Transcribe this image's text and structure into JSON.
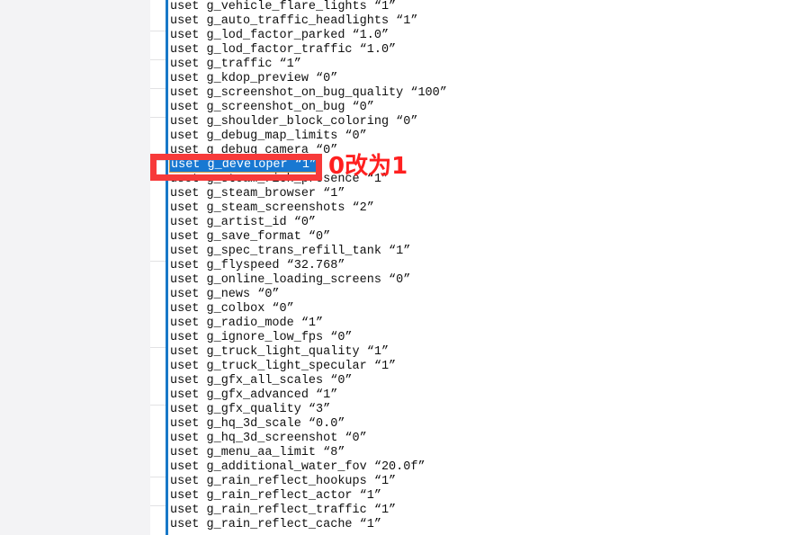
{
  "document": {
    "type": "config-file-text",
    "background_color": "#ffffff",
    "page_backdrop_color": "#f3f3f5",
    "code_bar_color": "#1878c8",
    "text_color": "#101010",
    "line_height_px": 16,
    "lines": [
      {
        "text": "uset g_vehicle_flare_lights “1”"
      },
      {
        "text": "uset g_auto_traffic_headlights “1”"
      },
      {
        "text": "uset g_lod_factor_parked “1.0”"
      },
      {
        "text": "uset g_lod_factor_traffic “1.0”"
      },
      {
        "text": "uset g_traffic “1”"
      },
      {
        "text": "uset g_kdop_preview “0”"
      },
      {
        "text": "uset g_screenshot_on_bug_quality “100”"
      },
      {
        "text": "uset g_screenshot_on_bug “0”"
      },
      {
        "text": "uset g_shoulder_block_coloring “0”"
      },
      {
        "text": "uset g_debug_map_limits “0”"
      },
      {
        "text": "uset g_debug_camera “0”",
        "occluded": true
      },
      {
        "text": "uset g_developer “1”",
        "selected": true
      },
      {
        "text": "uset g_steam_rich_presence “1”"
      },
      {
        "text": "uset g_steam_browser “1”"
      },
      {
        "text": "uset g_steam_screenshots “2”"
      },
      {
        "text": "uset g_artist_id “0”"
      },
      {
        "text": "uset g_save_format “0”"
      },
      {
        "text": "uset g_spec_trans_refill_tank “1”"
      },
      {
        "text": "uset g_flyspeed “32.768”"
      },
      {
        "text": "uset g_online_loading_screens “0”"
      },
      {
        "text": "uset g_news “0”"
      },
      {
        "text": "uset g_colbox “0”"
      },
      {
        "text": "uset g_radio_mode “1”"
      },
      {
        "text": "uset g_ignore_low_fps “0”"
      },
      {
        "text": "uset g_truck_light_quality “1”"
      },
      {
        "text": "uset g_truck_light_specular “1”"
      },
      {
        "text": "uset g_gfx_all_scales “0”"
      },
      {
        "text": "uset g_gfx_advanced “1”"
      },
      {
        "text": "uset g_gfx_quality “3”"
      },
      {
        "text": "uset g_hq_3d_scale “0.0”"
      },
      {
        "text": "uset g_hq_3d_screenshot “0”"
      },
      {
        "text": "uset g_menu_aa_limit “8”"
      },
      {
        "text": "uset g_additional_water_fov “20.0f”"
      },
      {
        "text": "uset g_rain_reflect_hookups “1”"
      },
      {
        "text": "uset g_rain_reflect_actor “1”"
      },
      {
        "text": "uset g_rain_reflect_traffic “1”"
      },
      {
        "text": "uset g_rain_reflect_cache “1”"
      }
    ]
  },
  "selection": {
    "line_text": "uset g_developer “1”",
    "highlight_color": "#1878d2",
    "text_color": "#ffffff",
    "border_color": "#d89a3a"
  },
  "annotation": {
    "box_color": "#f73a3a",
    "text": "0改为1",
    "text_color": "#ff2020"
  },
  "gutter": {
    "rule_color": "#e2e2e4",
    "rule_offsets": [
      34,
      66,
      98,
      130,
      178,
      290,
      386,
      450,
      530,
      562
    ]
  }
}
